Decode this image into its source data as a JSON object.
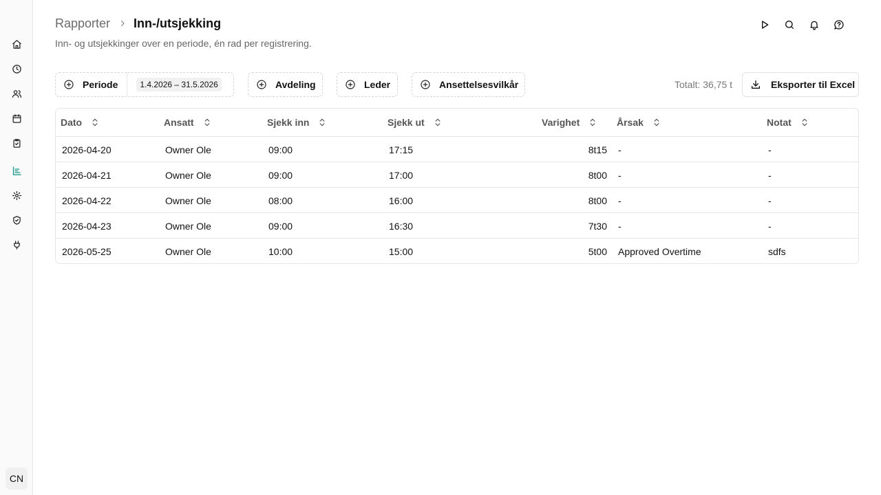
{
  "sidebar": {
    "items": [
      {
        "name": "home-icon"
      },
      {
        "name": "clock-icon"
      },
      {
        "name": "users-icon"
      },
      {
        "name": "calendar-icon"
      },
      {
        "name": "clipboard-check-icon"
      },
      {
        "name": "report-chart-icon",
        "active": true
      },
      {
        "name": "gear-icon"
      },
      {
        "name": "shield-check-icon"
      },
      {
        "name": "plug-icon"
      }
    ],
    "avatar": "CN",
    "accent_color": "#0d9488"
  },
  "header": {
    "breadcrumb_parent": "Rapporter",
    "breadcrumb_current": "Inn-/utsjekking",
    "subtitle": "Inn- og utsjekkinger over en periode, én rad per registrering.",
    "actions": [
      "play-icon",
      "search-icon",
      "bell-icon",
      "help-circle-icon"
    ]
  },
  "filters": {
    "period_label": "Periode",
    "period_value": "1.4.2026 – 31.5.2026",
    "department_label": "Avdeling",
    "manager_label": "Leder",
    "terms_label": "Ansettelsesvilkår"
  },
  "summary": {
    "total": "Totalt: 36,75 t",
    "export_label": "Eksporter til Excel"
  },
  "table": {
    "headers": {
      "date": "Dato",
      "employee": "Ansatt",
      "check_in": "Sjekk inn",
      "check_out": "Sjekk ut",
      "duration": "Varighet",
      "reason": "Årsak",
      "note": "Notat"
    },
    "rows": [
      {
        "date": "2026-04-20",
        "employee": "Owner Ole",
        "check_in": "09:00",
        "check_out": "17:15",
        "duration": "8t15",
        "reason": "-",
        "note": "-"
      },
      {
        "date": "2026-04-21",
        "employee": "Owner Ole",
        "check_in": "09:00",
        "check_out": "17:00",
        "duration": "8t00",
        "reason": "-",
        "note": "-"
      },
      {
        "date": "2026-04-22",
        "employee": "Owner Ole",
        "check_in": "08:00",
        "check_out": "16:00",
        "duration": "8t00",
        "reason": "-",
        "note": "-"
      },
      {
        "date": "2026-04-23",
        "employee": "Owner Ole",
        "check_in": "09:00",
        "check_out": "16:30",
        "duration": "7t30",
        "reason": "-",
        "note": "-"
      },
      {
        "date": "2026-05-25",
        "employee": "Owner Ole",
        "check_in": "10:00",
        "check_out": "15:00",
        "duration": "5t00",
        "reason": "Approved Overtime",
        "note": "sdfs"
      }
    ]
  }
}
